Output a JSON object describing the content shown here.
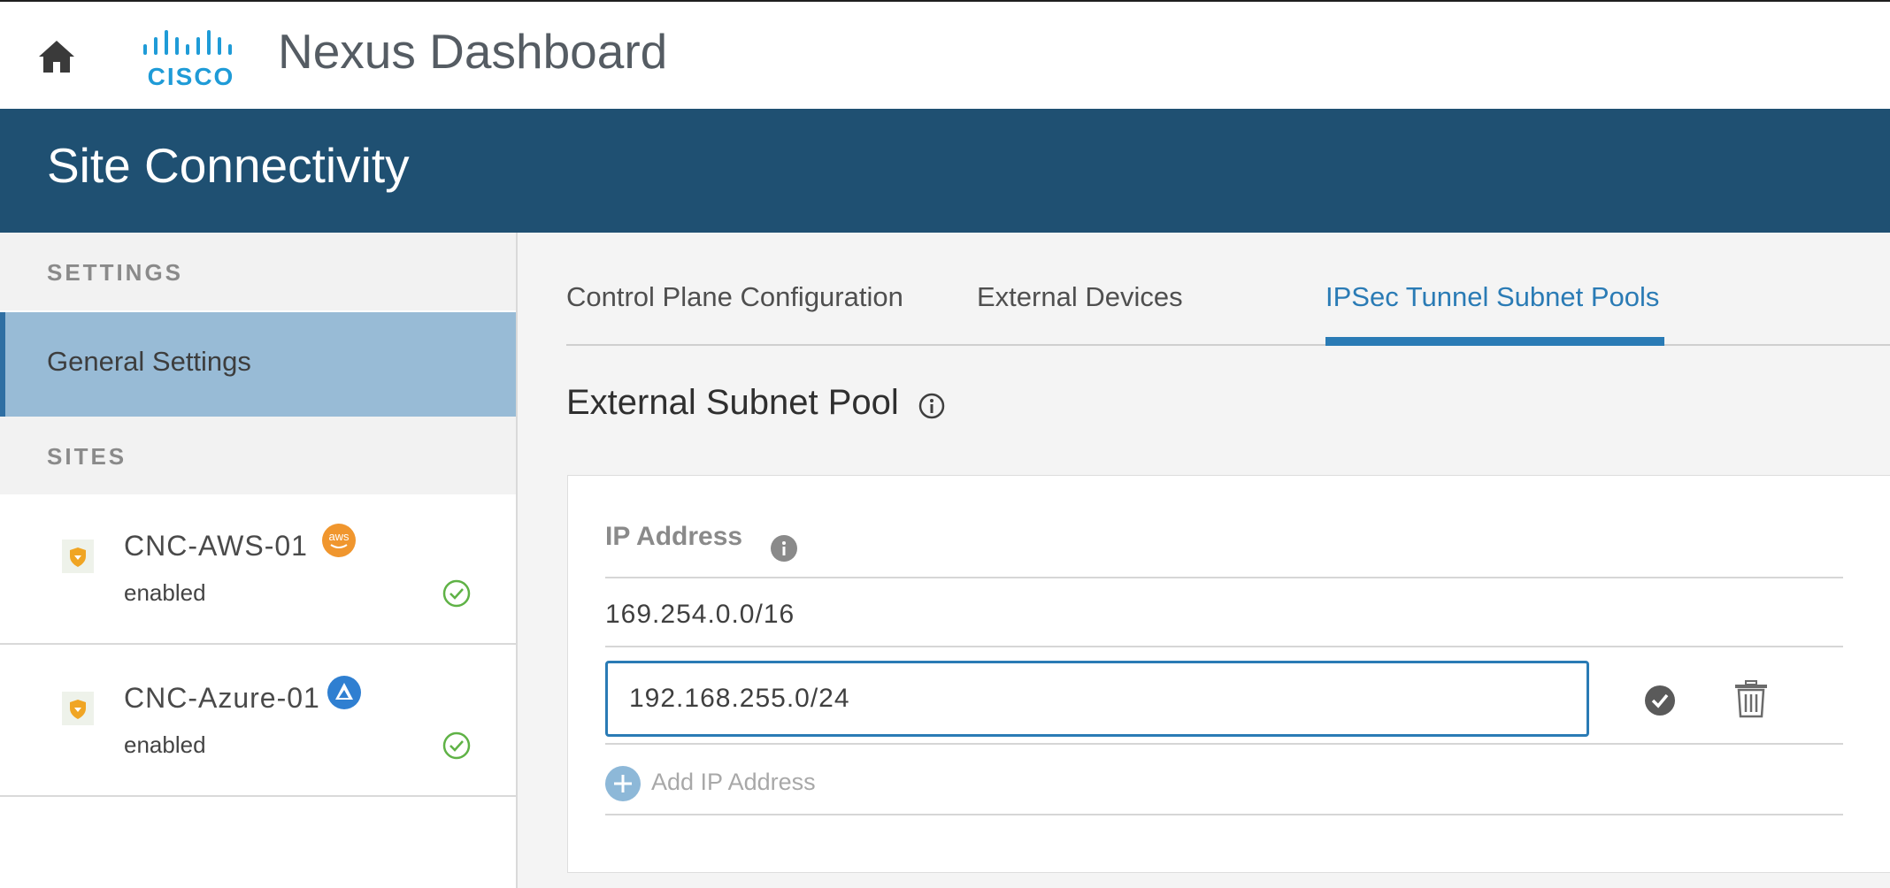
{
  "topbar": {
    "icon_home": "home-icon",
    "logo_text": "CISCO",
    "title": "Nexus Dashboard"
  },
  "banner": {
    "title": "Site Connectivity"
  },
  "sidebar": {
    "settings_header": "SETTINGS",
    "general_settings_label": "General Settings",
    "sites_header": "SITES",
    "sites": [
      {
        "name": "CNC-AWS-01",
        "status": "enabled",
        "cloud": "aws",
        "badge_text": "aws",
        "badge_color": "#f0962e"
      },
      {
        "name": "CNC-Azure-01",
        "status": "enabled",
        "cloud": "azure",
        "badge_text": "",
        "badge_color": "#2f7fd1"
      }
    ]
  },
  "main": {
    "tabs": [
      {
        "label": "Control Plane Configuration",
        "active": false
      },
      {
        "label": "External Devices",
        "active": false
      },
      {
        "label": "IPSec Tunnel Subnet Pools",
        "active": true
      }
    ],
    "section_title": "External Subnet Pool",
    "table": {
      "header": "IP Address",
      "rows": [
        "169.254.0.0/16"
      ],
      "editing_value": "192.168.255.0/24",
      "add_label": "Add IP Address"
    }
  },
  "colors": {
    "banner": "#1f5072",
    "accent": "#2a7bb5",
    "sidebar_selected": "#98bbd6",
    "success": "#5fb246"
  }
}
